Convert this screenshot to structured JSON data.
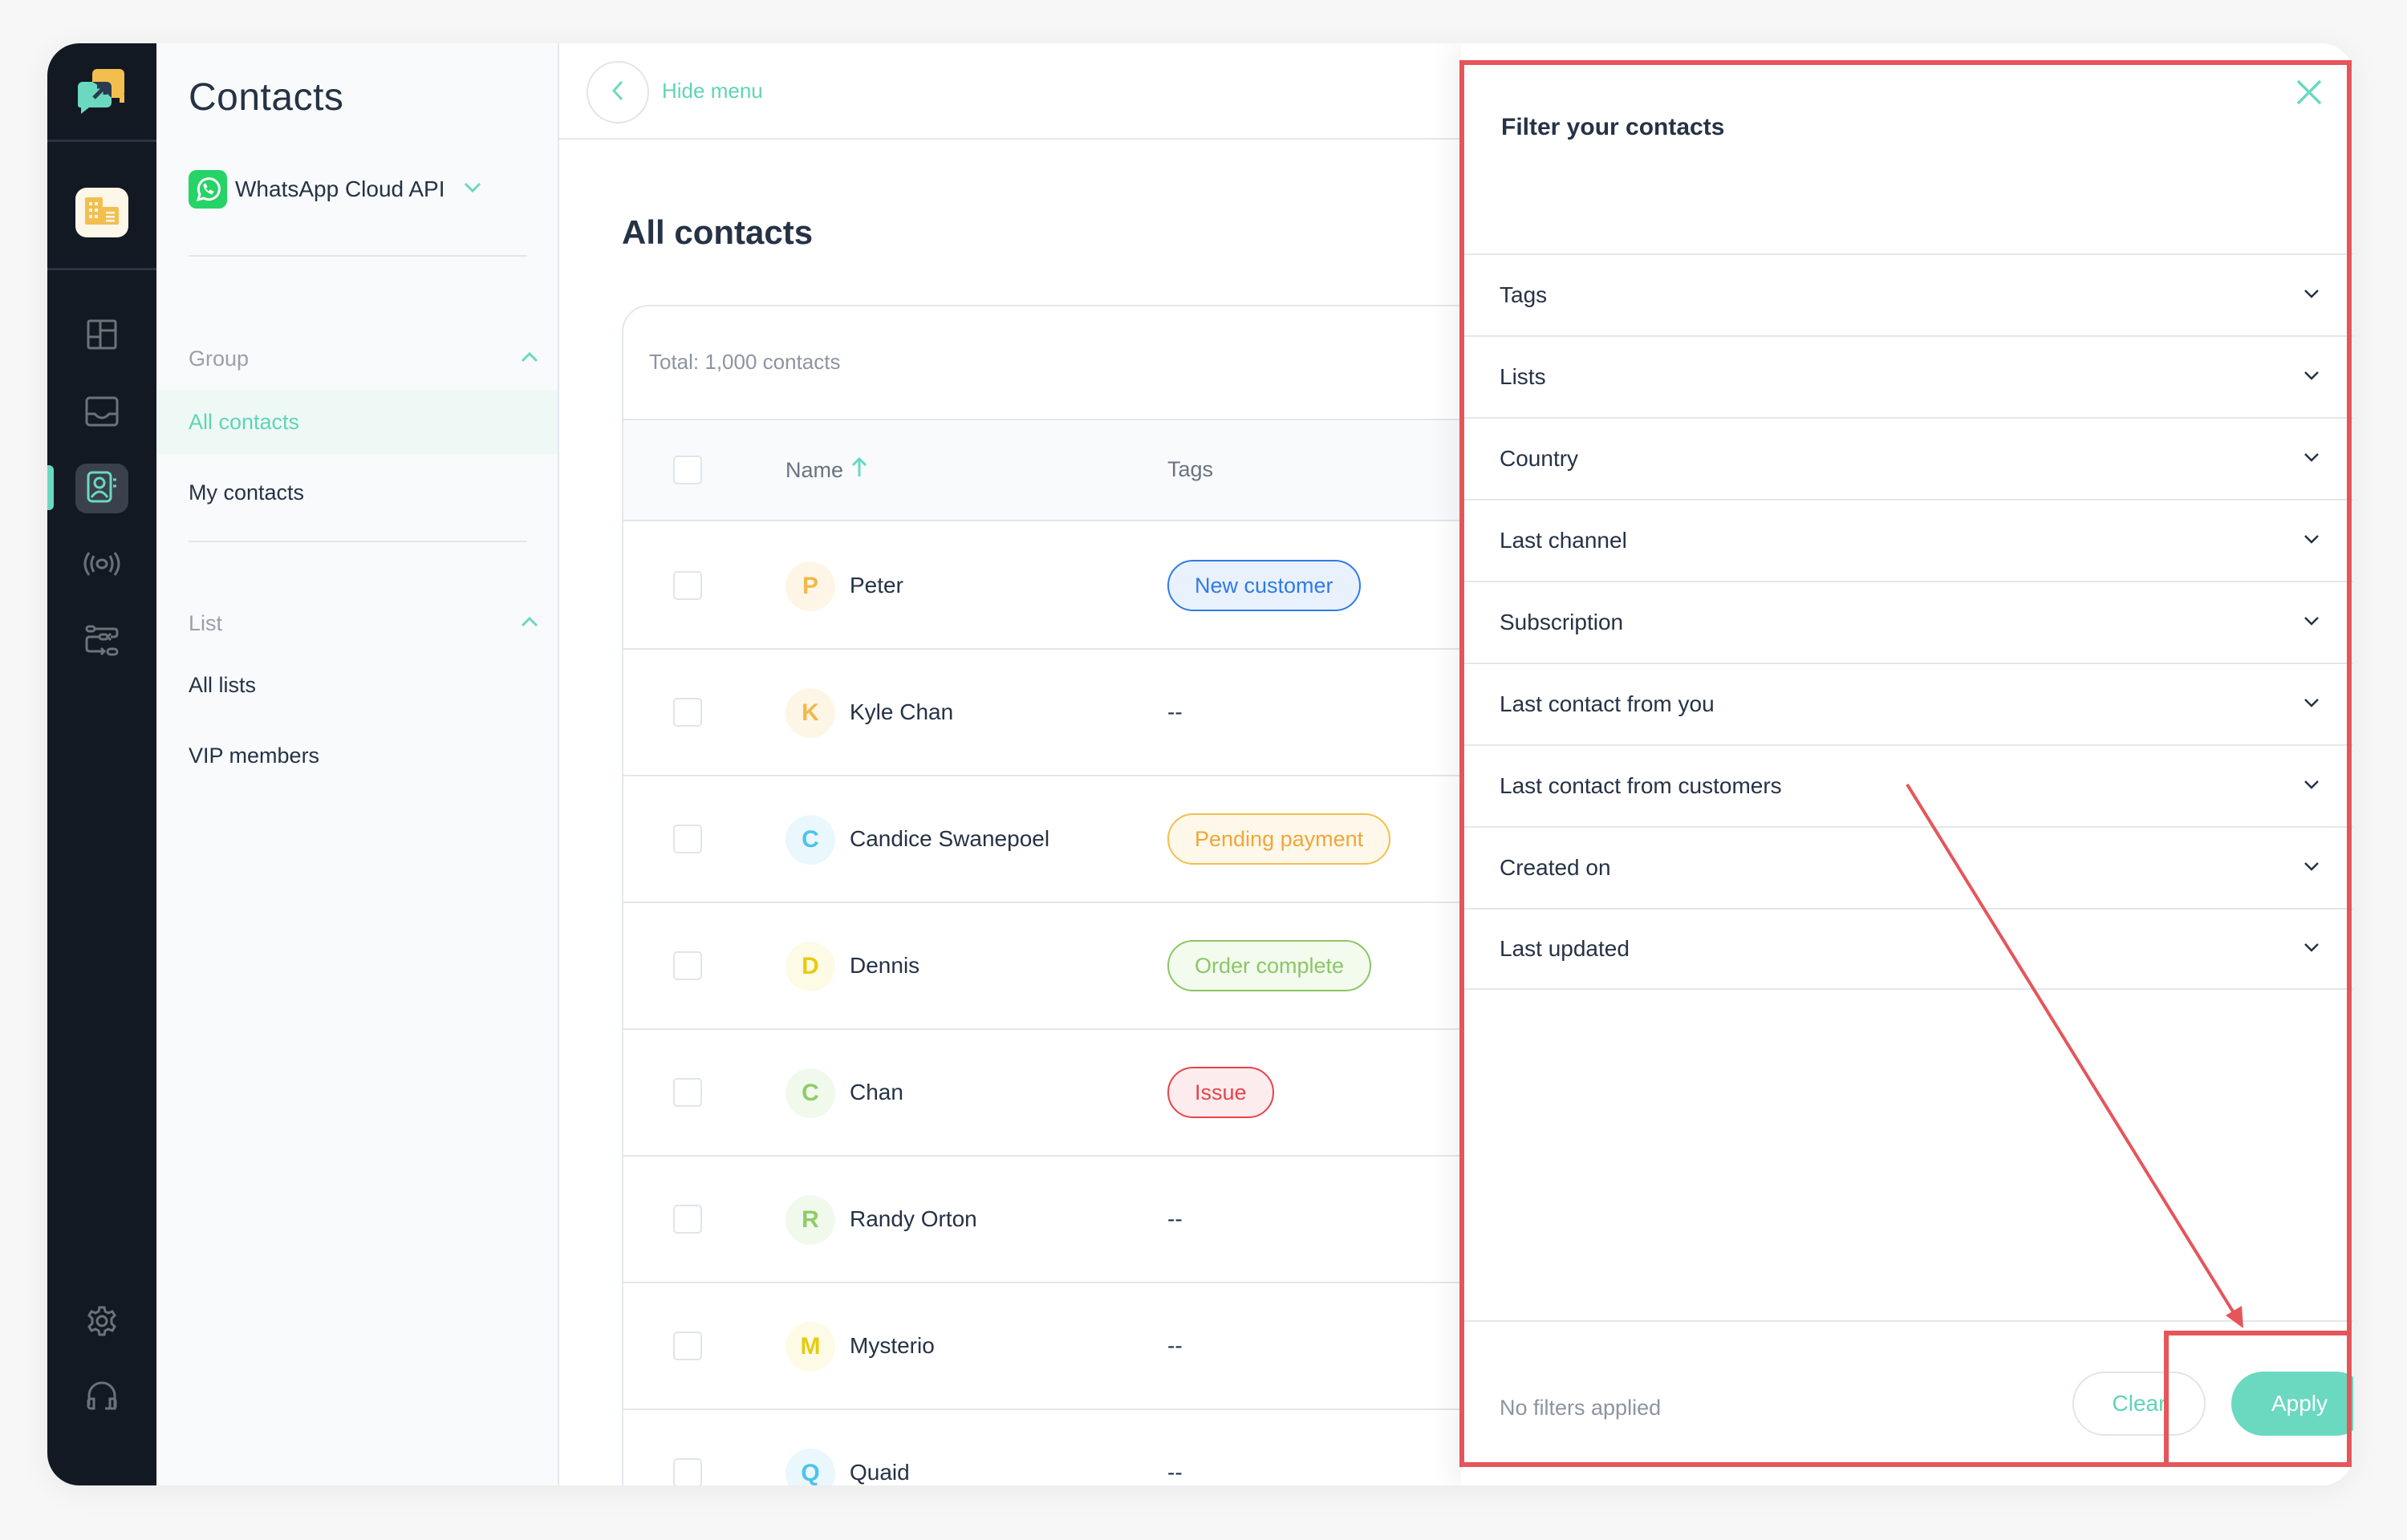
{
  "app": {
    "brand_colors": {
      "accent": "#6ad9c0",
      "sidebar_bg": "#131922",
      "annotation": "#e5555a"
    }
  },
  "rail": {
    "logo": "chat-logo-icon",
    "workspace_icon": "building-icon",
    "items": [
      {
        "icon": "dashboard-icon",
        "active": false
      },
      {
        "icon": "inbox-icon",
        "active": false
      },
      {
        "icon": "contacts-icon",
        "active": true
      },
      {
        "icon": "broadcast-icon",
        "active": false
      },
      {
        "icon": "automation-flow-icon",
        "active": false
      }
    ],
    "bottom": [
      {
        "icon": "settings-gear-icon"
      },
      {
        "icon": "headset-support-icon"
      }
    ]
  },
  "panel": {
    "title": "Contacts",
    "channel": {
      "label": "WhatsApp Cloud API",
      "icon": "whatsapp-icon"
    },
    "group": {
      "heading": "Group",
      "items": [
        {
          "label": "All contacts",
          "active": true
        },
        {
          "label": "My contacts",
          "active": false
        }
      ]
    },
    "list": {
      "heading": "List",
      "items": [
        {
          "label": "All lists",
          "active": false
        },
        {
          "label": "VIP members",
          "active": false
        }
      ]
    }
  },
  "main": {
    "hide_menu": "Hide menu",
    "title": "All contacts",
    "total": "Total: 1,000 contacts",
    "columns": {
      "name": "Name",
      "tags": "Tags"
    },
    "rows": [
      {
        "initial": "P",
        "name": "Peter",
        "tag": "New customer",
        "tag_style": "blue",
        "avatar_fg": "#f2b84b",
        "avatar_bg": "#fdf6e6"
      },
      {
        "initial": "K",
        "name": "Kyle Chan",
        "tag": "--",
        "tag_style": "none",
        "avatar_fg": "#f2b84b",
        "avatar_bg": "#fdf6e6"
      },
      {
        "initial": "C",
        "name": "Candice Swanepoel",
        "tag": "Pending payment",
        "tag_style": "orange",
        "avatar_fg": "#4cc3ec",
        "avatar_bg": "#eaf7fd"
      },
      {
        "initial": "D",
        "name": "Dennis",
        "tag": "Order complete",
        "tag_style": "green",
        "avatar_fg": "#e6cc10",
        "avatar_bg": "#fdfae6"
      },
      {
        "initial": "C",
        "name": "Chan",
        "tag": "Issue",
        "tag_style": "red",
        "avatar_fg": "#8fcc66",
        "avatar_bg": "#f1f9ec"
      },
      {
        "initial": "R",
        "name": "Randy Orton",
        "tag": "--",
        "tag_style": "none",
        "avatar_fg": "#8fcc66",
        "avatar_bg": "#f1f9ec"
      },
      {
        "initial": "M",
        "name": "Mysterio",
        "tag": "--",
        "tag_style": "none",
        "avatar_fg": "#e6cc10",
        "avatar_bg": "#fdfae6"
      },
      {
        "initial": "Q",
        "name": "Quaid",
        "tag": "--",
        "tag_style": "none",
        "avatar_fg": "#4cc3ec",
        "avatar_bg": "#eaf7fd"
      }
    ],
    "tag_styles": {
      "blue": {
        "fg": "#2f7be5",
        "bg": "#e9f1fd",
        "border": "#2f7be5"
      },
      "orange": {
        "fg": "#f0a63a",
        "bg": "#fef8ea",
        "border": "#f2bf4f"
      },
      "green": {
        "fg": "#8ac763",
        "bg": "#f3faee",
        "border": "#8ac763"
      },
      "red": {
        "fg": "#e5444a",
        "bg": "#fdeced",
        "border": "#e5444a"
      }
    }
  },
  "filter": {
    "title": "Filter your contacts",
    "options": [
      "Tags",
      "Lists",
      "Country",
      "Last channel",
      "Subscription",
      "Last contact from you",
      "Last contact from customers",
      "Created on",
      "Last updated"
    ],
    "status": "No filters applied",
    "clear_label": "Clear",
    "apply_label": "Apply"
  }
}
